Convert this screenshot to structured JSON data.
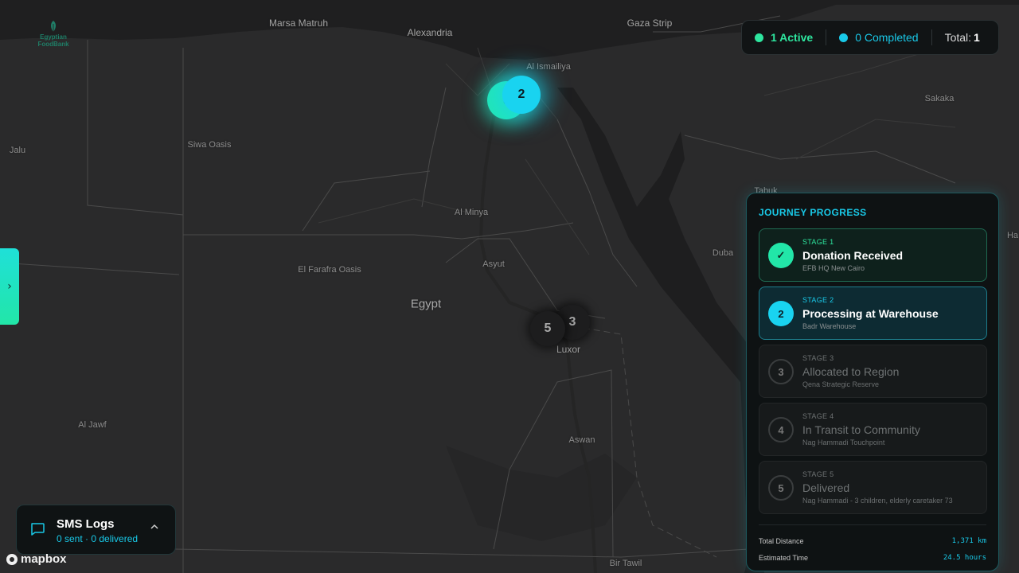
{
  "map": {
    "labels": [
      {
        "text": "Marsa Matruh",
        "kind": "city"
      },
      {
        "text": "Alexandria",
        "kind": "city"
      },
      {
        "text": "Gaza Strip",
        "kind": "city"
      },
      {
        "text": "Al Ismailiya",
        "kind": "place"
      },
      {
        "text": "Sakaka",
        "kind": "place"
      },
      {
        "text": "Jalu",
        "kind": "place"
      },
      {
        "text": "Siwa Oasis",
        "kind": "place"
      },
      {
        "text": "Al Minya",
        "kind": "place"
      },
      {
        "text": "Tabuk",
        "kind": "place"
      },
      {
        "text": "Duba",
        "kind": "place"
      },
      {
        "text": "El Farafra Oasis",
        "kind": "place"
      },
      {
        "text": "Asyut",
        "kind": "place"
      },
      {
        "text": "Egypt",
        "kind": "country"
      },
      {
        "text": "Luxor",
        "kind": "city"
      },
      {
        "text": "Al Jawf",
        "kind": "place"
      },
      {
        "text": "Aswan",
        "kind": "place"
      },
      {
        "text": "Bir Tawil",
        "kind": "place"
      },
      {
        "text": "Ha",
        "kind": "place"
      }
    ],
    "clusters": [
      {
        "count": "0",
        "style": "green"
      },
      {
        "count": "2",
        "style": "cyan"
      },
      {
        "count": "5",
        "style": "dark"
      },
      {
        "count": "3",
        "style": "dark"
      }
    ]
  },
  "logo": {
    "line1": "Egyptian",
    "line2": "FoodBank"
  },
  "status_bar": {
    "active_label": "1 Active",
    "completed_label": "0 Completed",
    "total_label": "Total:",
    "total_value": "1",
    "colors": {
      "active": "#2ee69f",
      "completed": "#19c9e8"
    }
  },
  "side_toggle": {
    "icon": "chevron-right-icon",
    "glyph": "›"
  },
  "journey": {
    "title": "JOURNEY PROGRESS",
    "stages": [
      {
        "stage_no": "STAGE 1",
        "name": "Donation Received",
        "location": "EFB HQ New Cairo",
        "status": "done",
        "badge": "✓"
      },
      {
        "stage_no": "STAGE 2",
        "name": "Processing at Warehouse",
        "location": "Badr Warehouse",
        "status": "current",
        "badge": "2"
      },
      {
        "stage_no": "STAGE 3",
        "name": "Allocated to Region",
        "location": "Qena Strategic Reserve",
        "status": "pending",
        "badge": "3"
      },
      {
        "stage_no": "STAGE 4",
        "name": "In Transit to Community",
        "location": "Nag Hammadi Touchpoint",
        "status": "pending",
        "badge": "4"
      },
      {
        "stage_no": "STAGE 5",
        "name": "Delivered",
        "location": "Nag Hammadi - 3 children, elderly caretaker 73",
        "status": "pending",
        "badge": "5"
      }
    ],
    "metrics": {
      "distance_label": "Total Distance",
      "distance_value": "1,371 km",
      "time_label": "Estimated Time",
      "time_value": "24.5 hours"
    }
  },
  "sms": {
    "icon": "chat-icon",
    "title": "SMS Logs",
    "subtitle": "0 sent · 0 delivered",
    "chevron": "^"
  },
  "attribution": {
    "brand": "mapbox"
  }
}
